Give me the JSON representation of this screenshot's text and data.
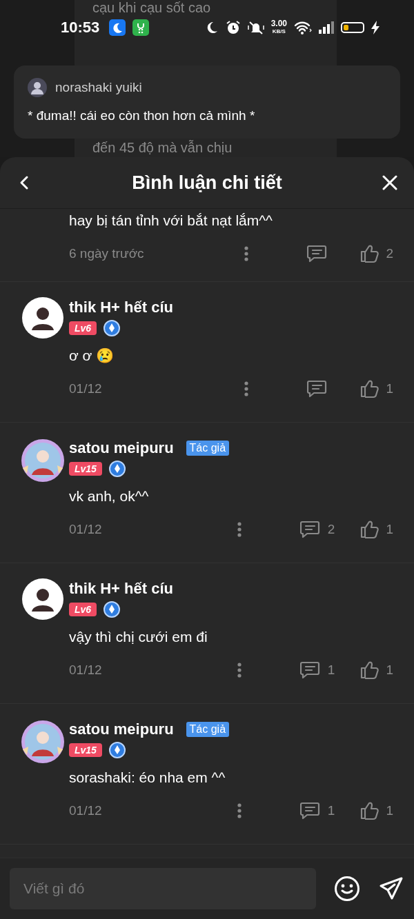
{
  "background_page": {
    "lines": [
      "cạu khi cạu sốt cao",
      "đến 45 độ mà vẫn chịu"
    ]
  },
  "status_bar": {
    "time": "10:53",
    "net_speed": "3.00",
    "net_unit": "KB/S"
  },
  "notification": {
    "user": "norashaki yuiki",
    "text": "* đuma!! cái eo còn thon hơn cả mình *"
  },
  "sheet": {
    "title": "Bình luận chi tiết"
  },
  "partial_comment": {
    "text": "hay bị tán tỉnh với bắt nạt lắm^^",
    "time": "6 ngày trước",
    "likes": "2"
  },
  "comments": [
    {
      "user": "thik H+ hết cíu",
      "kind": "reader",
      "level": "Lv6",
      "text": "ơ ơ 😢",
      "time": "01/12",
      "likes": "1"
    },
    {
      "user": "satou meipuru",
      "kind": "author",
      "level": "Lv15",
      "author_tag": "Tác giả",
      "text": "vk anh, ok^^",
      "time": "01/12",
      "replies": "2",
      "likes": "1"
    },
    {
      "user": "thik H+ hết cíu",
      "kind": "reader",
      "level": "Lv6",
      "text": "vậy thì chị cưới em đi",
      "time": "01/12",
      "replies": "1",
      "likes": "1"
    },
    {
      "user": "satou meipuru",
      "kind": "author",
      "level": "Lv15",
      "author_tag": "Tác giả",
      "text": "sorashaki: éo nha em ^^",
      "time": "01/12",
      "replies": "1",
      "likes": "1"
    }
  ],
  "composer": {
    "placeholder": "Viết gì đó"
  }
}
